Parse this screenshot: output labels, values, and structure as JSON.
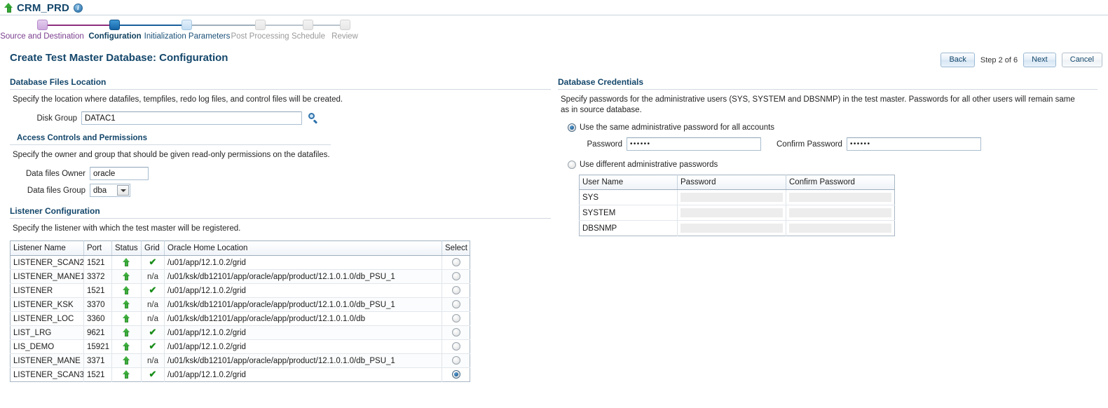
{
  "header": {
    "up_arrow_icon": "up-arrow-icon",
    "db_name": "CRM_PRD",
    "info_icon": "i"
  },
  "train": {
    "steps": [
      {
        "label": "Source and Destination",
        "state": "visited"
      },
      {
        "label": "Configuration",
        "state": "current"
      },
      {
        "label": "Initialization Parameters",
        "state": "next"
      },
      {
        "label": "Post Processing",
        "state": "disabled"
      },
      {
        "label": "Schedule",
        "state": "disabled"
      },
      {
        "label": "Review",
        "state": "disabled"
      }
    ]
  },
  "title_bar": {
    "page_title": "Create Test Master Database: Configuration",
    "back_label": "Back",
    "step_text": "Step 2 of 6",
    "next_label": "Next",
    "cancel_label": "Cancel"
  },
  "database_files_location": {
    "heading": "Database Files Location",
    "description": "Specify the location where datafiles, tempfiles, redo log files, and control files will be created.",
    "disk_group_label": "Disk Group",
    "disk_group_value": "DATAC1",
    "search_icon": "search-icon"
  },
  "access_controls": {
    "heading": "Access Controls and Permissions",
    "description": "Specify the owner and group that should be given read-only permissions on the datafiles.",
    "owner_label": "Data files Owner",
    "owner_value": "oracle",
    "group_label": "Data files Group",
    "group_value": "dba"
  },
  "listener_configuration": {
    "heading": "Listener Configuration",
    "description": "Specify the listener with which the test master will be registered.",
    "columns": [
      "Listener Name",
      "Port",
      "Status",
      "Grid",
      "Oracle Home Location",
      "Select"
    ],
    "rows": [
      {
        "name": "LISTENER_SCAN2",
        "port": "1521",
        "status": "up",
        "grid": "yes",
        "grid_text": "",
        "home": "/u01/app/12.1.0.2/grid",
        "selected": false
      },
      {
        "name": "LISTENER_MANE1",
        "port": "3372",
        "status": "up",
        "grid": "na",
        "grid_text": "n/a",
        "home": "/u01/ksk/db12101/app/oracle/app/product/12.1.0.1.0/db_PSU_1",
        "selected": false
      },
      {
        "name": "LISTENER",
        "port": "1521",
        "status": "up",
        "grid": "yes",
        "grid_text": "",
        "home": "/u01/app/12.1.0.2/grid",
        "selected": false
      },
      {
        "name": "LISTENER_KSK",
        "port": "3370",
        "status": "up",
        "grid": "na",
        "grid_text": "n/a",
        "home": "/u01/ksk/db12101/app/oracle/app/product/12.1.0.1.0/db_PSU_1",
        "selected": false
      },
      {
        "name": "LISTENER_LOC",
        "port": "3360",
        "status": "up",
        "grid": "na",
        "grid_text": "n/a",
        "home": "/u01/ksk/db12101/app/oracle/app/product/12.1.0.1.0/db",
        "selected": false
      },
      {
        "name": "LIST_LRG",
        "port": "9621",
        "status": "up",
        "grid": "yes",
        "grid_text": "",
        "home": "/u01/app/12.1.0.2/grid",
        "selected": false
      },
      {
        "name": "LIS_DEMO",
        "port": "15921",
        "status": "up",
        "grid": "yes",
        "grid_text": "",
        "home": "/u01/app/12.1.0.2/grid",
        "selected": false
      },
      {
        "name": "LISTENER_MANE",
        "port": "3371",
        "status": "up",
        "grid": "na",
        "grid_text": "n/a",
        "home": "/u01/ksk/db12101/app/oracle/app/product/12.1.0.1.0/db_PSU_1",
        "selected": false
      },
      {
        "name": "LISTENER_SCAN3",
        "port": "1521",
        "status": "up",
        "grid": "yes",
        "grid_text": "",
        "home": "/u01/app/12.1.0.2/grid",
        "selected": true
      }
    ]
  },
  "database_credentials": {
    "heading": "Database Credentials",
    "description": "Specify passwords for the administrative users (SYS, SYSTEM and DBSNMP) in the test master. Passwords for all other users will remain same as in source database.",
    "same_password_option": "Use the same administrative password for all accounts",
    "same_password_selected": true,
    "password_label": "Password",
    "password_value": "••••••",
    "confirm_password_label": "Confirm Password",
    "confirm_password_value": "••••••",
    "different_password_option": "Use different administrative passwords",
    "different_password_selected": false,
    "columns": [
      "User Name",
      "Password",
      "Confirm Password"
    ],
    "rows": [
      {
        "user": "SYS",
        "password": "",
        "confirm": ""
      },
      {
        "user": "SYSTEM",
        "password": "",
        "confirm": ""
      },
      {
        "user": "DBSNMP",
        "password": "",
        "confirm": ""
      }
    ]
  }
}
